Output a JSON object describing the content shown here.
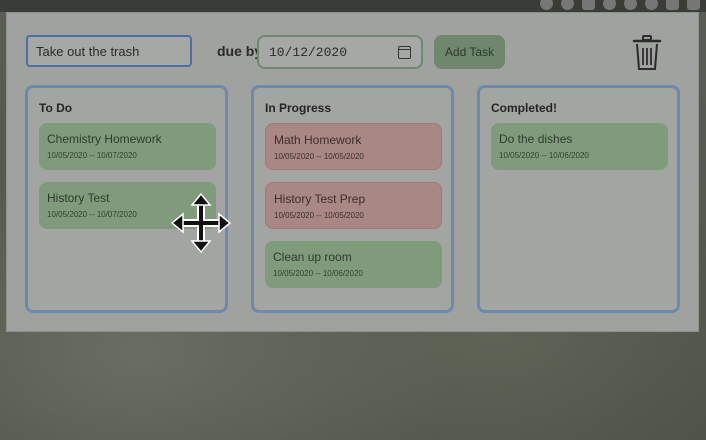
{
  "header": {
    "task_input_value": "Take out the trash",
    "due_label": "due by",
    "due_date_value": "10/12/2020",
    "add_button_label": "Add Task",
    "trash_icon": "trash-icon"
  },
  "columns": [
    {
      "title": "To Do",
      "cards": [
        {
          "title": "Chemistry Homework",
          "dates": "10/05/2020 -- 10/07/2020",
          "color": "green"
        },
        {
          "title": "History Test",
          "dates": "10/05/2020 -- 10/07/2020",
          "color": "green"
        }
      ]
    },
    {
      "title": "In Progress",
      "cards": [
        {
          "title": "Math Homework",
          "dates": "10/05/2020 -- 10/05/2020",
          "color": "red"
        },
        {
          "title": "History Test Prep",
          "dates": "10/05/2020 -- 10/05/2020",
          "color": "red"
        },
        {
          "title": "Clean up room",
          "dates": "10/05/2020 -- 10/06/2020",
          "color": "green"
        }
      ]
    },
    {
      "title": "Completed!",
      "cards": [
        {
          "title": "Do the dishes",
          "dates": "10/05/2020 -- 10/06/2020",
          "color": "green"
        }
      ]
    }
  ],
  "colors": {
    "card_green": "#7f9b7c",
    "card_red": "#a88785",
    "column_border": "#6f88ad",
    "input_focus_border": "#4f6ea8"
  },
  "cursor": "move-cursor-icon"
}
